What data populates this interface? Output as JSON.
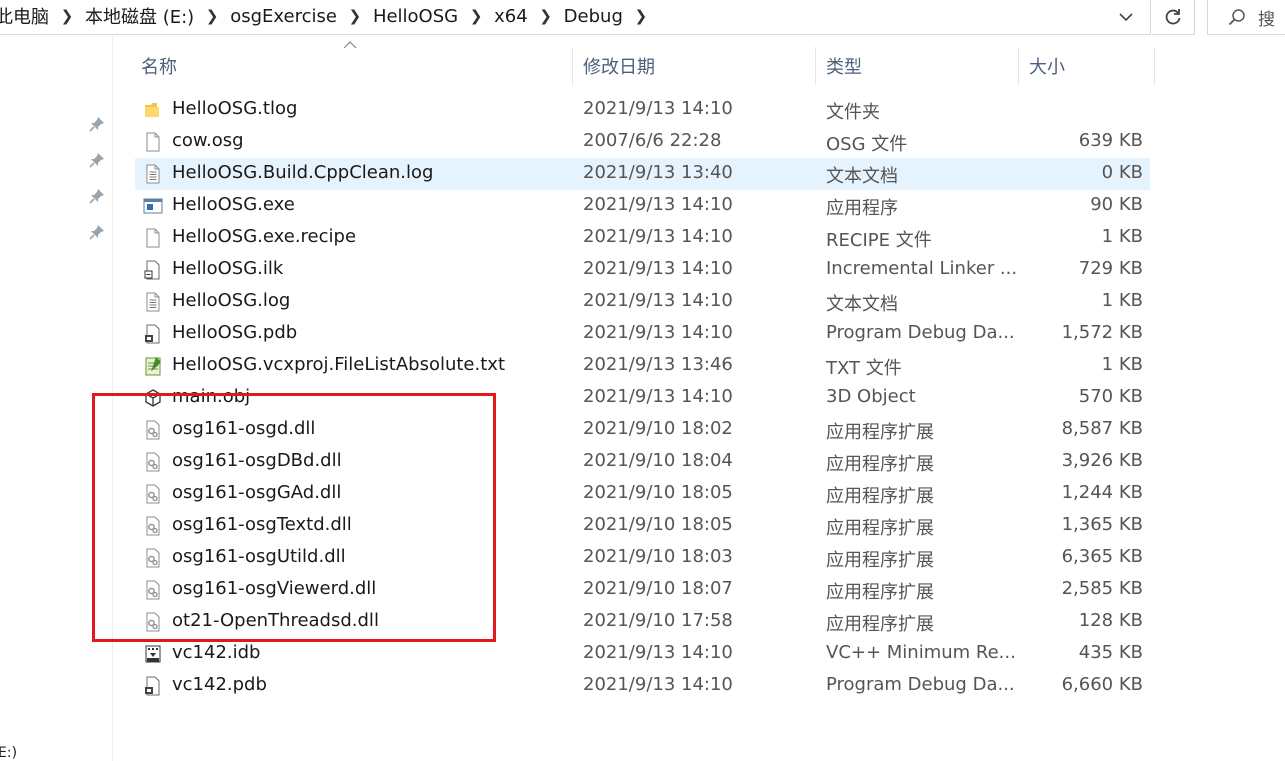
{
  "breadcrumb": [
    "此电脑",
    "本地磁盘 (E:)",
    "osgExercise",
    "HelloOSG",
    "x64",
    "Debug"
  ],
  "search_placeholder": "搜",
  "nav_bottom_text": "E:)",
  "columns": {
    "name": "名称",
    "date": "修改日期",
    "type": "类型",
    "size": "大小"
  },
  "files": [
    {
      "name": "HelloOSG.tlog",
      "date": "2021/9/13 14:10",
      "type": "文件夹",
      "size": "",
      "icon": "folder-icon"
    },
    {
      "name": "cow.osg",
      "date": "2007/6/6 22:28",
      "type": "OSG 文件",
      "size": "639 KB",
      "icon": "file-icon"
    },
    {
      "name": "HelloOSG.Build.CppClean.log",
      "date": "2021/9/13 13:40",
      "type": "文本文档",
      "size": "0 KB",
      "icon": "text-file-icon",
      "selected": true
    },
    {
      "name": "HelloOSG.exe",
      "date": "2021/9/13 14:10",
      "type": "应用程序",
      "size": "90 KB",
      "icon": "exe-icon"
    },
    {
      "name": "HelloOSG.exe.recipe",
      "date": "2021/9/13 14:10",
      "type": "RECIPE 文件",
      "size": "1 KB",
      "icon": "file-icon"
    },
    {
      "name": "HelloOSG.ilk",
      "date": "2021/9/13 14:10",
      "type": "Incremental Linker ...",
      "size": "729 KB",
      "icon": "ilk-icon"
    },
    {
      "name": "HelloOSG.log",
      "date": "2021/9/13 14:10",
      "type": "文本文档",
      "size": "1 KB",
      "icon": "text-file-icon"
    },
    {
      "name": "HelloOSG.pdb",
      "date": "2021/9/13 14:10",
      "type": "Program Debug Da...",
      "size": "1,572 KB",
      "icon": "pdb-icon"
    },
    {
      "name": "HelloOSG.vcxproj.FileListAbsolute.txt",
      "date": "2021/9/13 13:46",
      "type": "TXT 文件",
      "size": "1 KB",
      "icon": "notepad-icon"
    },
    {
      "name": "main.obj",
      "date": "2021/9/13 14:10",
      "type": "3D Object",
      "size": "570 KB",
      "icon": "3d-object-icon"
    },
    {
      "name": "osg161-osgd.dll",
      "date": "2021/9/10 18:02",
      "type": "应用程序扩展",
      "size": "8,587 KB",
      "icon": "dll-icon"
    },
    {
      "name": "osg161-osgDBd.dll",
      "date": "2021/9/10 18:04",
      "type": "应用程序扩展",
      "size": "3,926 KB",
      "icon": "dll-icon"
    },
    {
      "name": "osg161-osgGAd.dll",
      "date": "2021/9/10 18:05",
      "type": "应用程序扩展",
      "size": "1,244 KB",
      "icon": "dll-icon"
    },
    {
      "name": "osg161-osgTextd.dll",
      "date": "2021/9/10 18:05",
      "type": "应用程序扩展",
      "size": "1,365 KB",
      "icon": "dll-icon"
    },
    {
      "name": "osg161-osgUtild.dll",
      "date": "2021/9/10 18:03",
      "type": "应用程序扩展",
      "size": "6,365 KB",
      "icon": "dll-icon"
    },
    {
      "name": "osg161-osgViewerd.dll",
      "date": "2021/9/10 18:07",
      "type": "应用程序扩展",
      "size": "2,585 KB",
      "icon": "dll-icon"
    },
    {
      "name": "ot21-OpenThreadsd.dll",
      "date": "2021/9/10 17:58",
      "type": "应用程序扩展",
      "size": "128 KB",
      "icon": "dll-icon"
    },
    {
      "name": "vc142.idb",
      "date": "2021/9/13 14:10",
      "type": "VC++ Minimum Re...",
      "size": "435 KB",
      "icon": "idb-icon"
    },
    {
      "name": "vc142.pdb",
      "date": "2021/9/13 14:10",
      "type": "Program Debug Da...",
      "size": "6,660 KB",
      "icon": "pdb-icon"
    }
  ],
  "annotation_color": "#e0191e",
  "selection_color": "#e5f3ff"
}
